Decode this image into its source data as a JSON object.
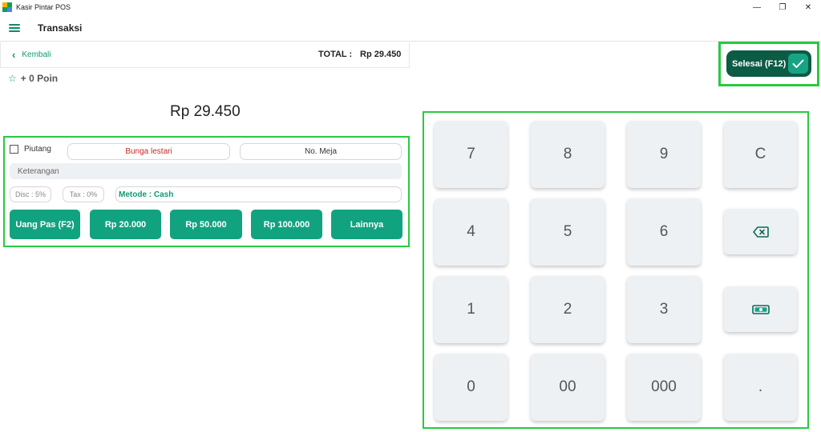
{
  "window": {
    "title": "Kasir Pintar POS",
    "minimize_glyph": "—",
    "restore_glyph": "❐",
    "close_glyph": "✕"
  },
  "header": {
    "title": "Transaksi"
  },
  "backbar": {
    "back_label": "Kembali",
    "total_label": "TOTAL :",
    "total_value": "Rp 29.450"
  },
  "points": {
    "label": "+ 0 Poin"
  },
  "amount": {
    "display": "Rp 29.450"
  },
  "payment": {
    "piutang_label": "Piutang",
    "customer_name": "Bunga lestari",
    "table_no": "No. Meja",
    "note_placeholder": "Keterangan",
    "discount": "Disc : 5%",
    "tax": "Tax : 0%",
    "method": "Metode : Cash",
    "quick_buttons": [
      "Uang Pas (F2)",
      "Rp 20.000",
      "Rp 50.000",
      "Rp 100.000",
      "Lainnya"
    ]
  },
  "done": {
    "label": "Selesai (F12)"
  },
  "keypad": {
    "keys": [
      "7",
      "8",
      "9",
      "C",
      "4",
      "5",
      "6",
      "1",
      "2",
      "3",
      "0",
      "00",
      "000",
      "."
    ],
    "icons": [
      "backspace-icon",
      "cash-icon"
    ]
  },
  "colors": {
    "accent": "#11a37f",
    "dark_accent": "#0c5b45",
    "highlight": "#29c940",
    "customer_text": "#c62828"
  }
}
